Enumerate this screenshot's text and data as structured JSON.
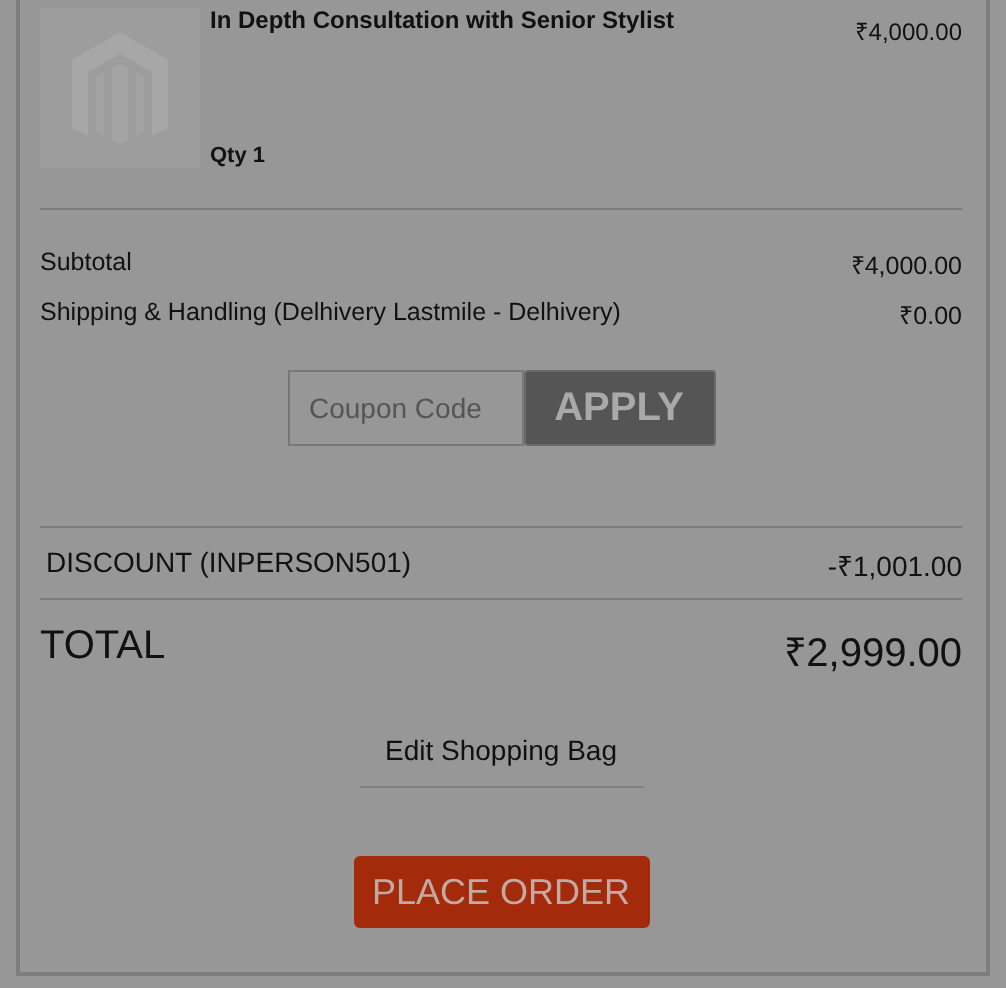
{
  "item": {
    "kind": "picture",
    "name": "In Depth Consultation with Senior Stylist",
    "price": "₹4,000.00",
    "qty": "Qty 1"
  },
  "totals": [
    {
      "label": "Subtotal",
      "value": "₹4,000.00"
    },
    {
      "label": "Shipping & Handling (Delhivery Lastmile - Delhivery)",
      "value": "₹0.00"
    }
  ],
  "coupon": {
    "placeholder": "Coupon Code",
    "button": "APPLY"
  },
  "discount": {
    "label": "DISCOUNT (INPERSON501)",
    "value": "-₹1,001.00"
  },
  "total": {
    "label": "TOTAL",
    "value": "₹2,999.00"
  },
  "edit_link": "Edit Shopping Bag",
  "place_order": "PLACE ORDER"
}
